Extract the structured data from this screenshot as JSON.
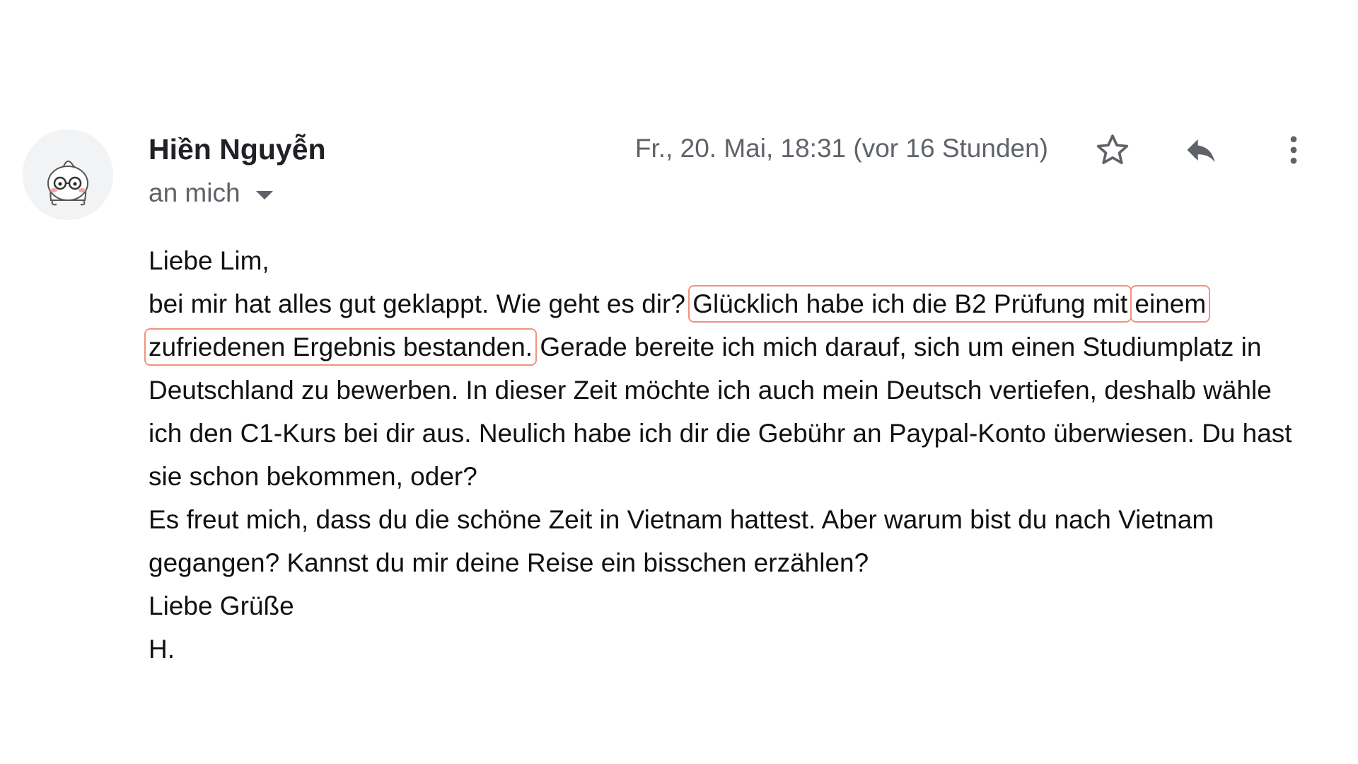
{
  "message": {
    "sender_name": "Hiền Nguyễn",
    "recipients_label": "an mich",
    "timestamp": "Fr., 20. Mai, 18:31 (vor 16 Stunden)",
    "icons": {
      "star": "star-icon",
      "reply": "reply-icon",
      "more": "more-vert-icon",
      "dropdown": "chevron-down-icon"
    },
    "body": {
      "greeting": "Liebe Lim,",
      "line1_part1": "bei mir hat alles gut geklappt. Wie geht es dir? ",
      "highlight_part1": "Glücklich habe ich die B2 Prüfung mit",
      "highlight_part2": "einem zufriedenen Ergebnis bestanden.",
      "line1_part2": " Gerade bereite ich mich darauf, sich um einen Studiumplatz in Deutschland zu bewerben. In dieser Zeit möchte ich auch mein Deutsch vertiefen, deshalb wähle ich den C1-Kurs bei dir aus. Neulich habe ich dir die Gebühr an Paypal-Konto überwiesen. Du hast sie schon bekommen, oder?",
      "paragraph2": "Es freut mich, dass du die schöne Zeit in Vietnam hattest. Aber warum bist du nach Vietnam gegangen? Kannst du mir deine Reise ein bisschen erzählen?",
      "closing": "Liebe Grüße",
      "signature": "H."
    },
    "colors": {
      "highlight_border": "#f0937e",
      "secondary_text": "#5f6368"
    }
  }
}
